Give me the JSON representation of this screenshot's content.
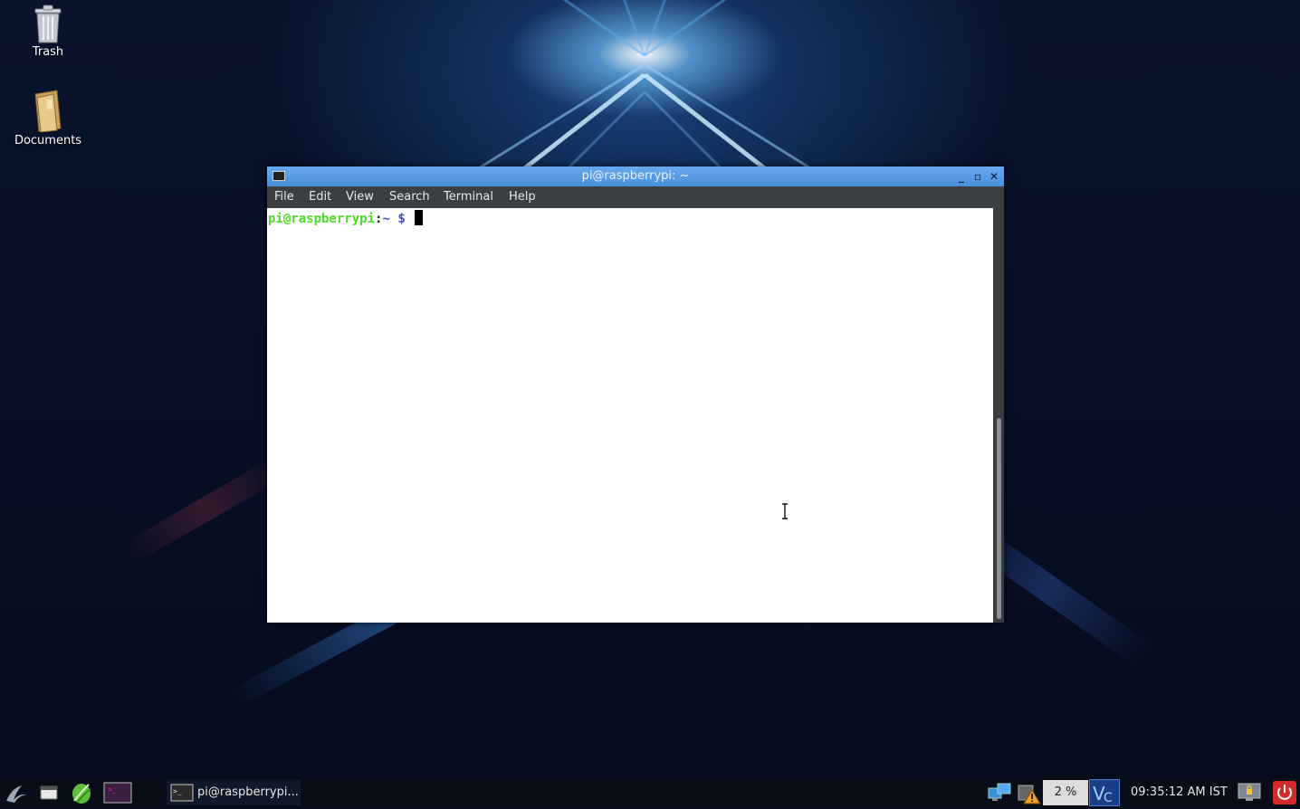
{
  "desktop": {
    "icons": [
      {
        "label": "Trash",
        "icon": "trash-icon"
      },
      {
        "label": "Documents",
        "icon": "folder-icon"
      }
    ]
  },
  "terminal": {
    "title": "pi@raspberrypi: ~",
    "menu": [
      "File",
      "Edit",
      "View",
      "Search",
      "Terminal",
      "Help"
    ],
    "prompt": {
      "user_host": "pi@raspberrypi",
      "colon": ":",
      "path": "~",
      "symbol": " $ "
    },
    "colors": {
      "user_host": "#4ade26",
      "path": "#3d4bd6",
      "titlebar": "#5a9de6"
    }
  },
  "taskbar": {
    "launchers": [
      "app-menu-icon",
      "file-manager-icon",
      "web-browser-icon",
      "terminal-icon"
    ],
    "task_label": "pi@raspberrypi...",
    "cpu_usage": "2 %",
    "clock": "09:35:12 AM IST"
  }
}
